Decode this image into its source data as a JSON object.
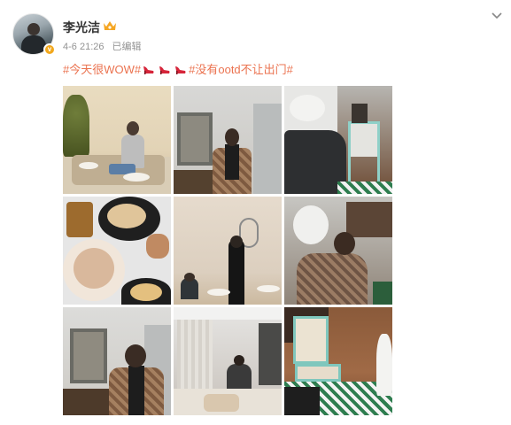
{
  "user": {
    "name": "李光洁",
    "time": "4-6 21:26",
    "edited": "已编辑",
    "verified_color": "#f2a81d"
  },
  "post": {
    "text_parts": [
      "#今天很WOW#",
      "#没有ootd不让出门#"
    ],
    "hashtag_color": "#eb7350",
    "emoji_icon": "red-high-heel-icon"
  },
  "photos": [
    {
      "label": "man-sitting-on-sofa"
    },
    {
      "label": "man-in-plaid-jacket-standing"
    },
    {
      "label": "director-chair-room"
    },
    {
      "label": "food-dishes-on-table"
    },
    {
      "label": "woman-in-black-coat"
    },
    {
      "label": "man-reclining-on-chair"
    },
    {
      "label": "man-standing-in-plaid-jacket"
    },
    {
      "label": "hotel-room-with-bed"
    },
    {
      "label": "director-chair-closeup"
    }
  ]
}
